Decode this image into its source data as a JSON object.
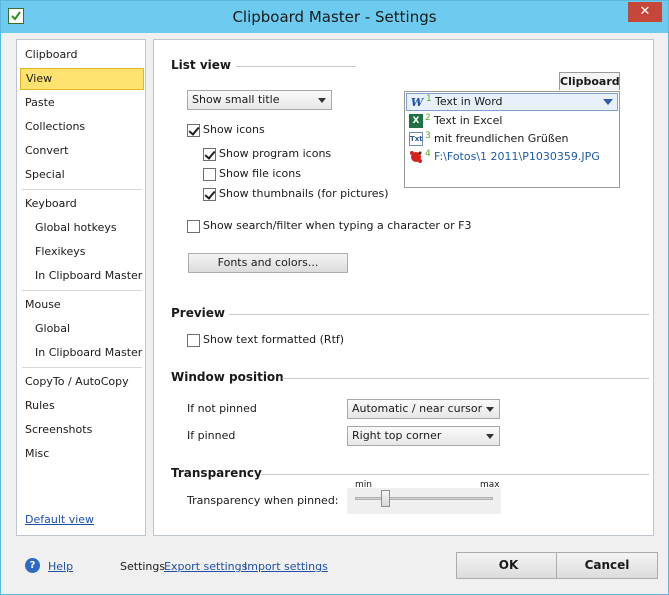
{
  "window": {
    "title": "Clipboard Master - Settings",
    "close_label": "✕"
  },
  "sidebar": {
    "items": [
      {
        "label": "Clipboard"
      },
      {
        "label": "View"
      },
      {
        "label": "Paste"
      },
      {
        "label": "Collections"
      },
      {
        "label": "Convert"
      },
      {
        "label": "Special"
      },
      {
        "label": "Keyboard"
      },
      {
        "label": "Global hotkeys"
      },
      {
        "label": "Flexikeys"
      },
      {
        "label": "In Clipboard Master"
      },
      {
        "label": "Mouse"
      },
      {
        "label": "Global"
      },
      {
        "label": "In Clipboard Master"
      },
      {
        "label": "CopyTo / AutoCopy"
      },
      {
        "label": "Rules"
      },
      {
        "label": "Screenshots"
      },
      {
        "label": "Misc"
      }
    ],
    "selected": "View",
    "default_view_link": "Default view"
  },
  "list_view": {
    "title": "List view",
    "title_dropdown": "Show small title",
    "show_icons": "Show icons",
    "show_program_icons": "Show program icons",
    "show_file_icons": "Show file icons",
    "show_thumbnails": "Show thumbnails (for pictures)",
    "show_search": "Show search/filter when typing a character or F3",
    "fonts_button": "Fonts and colors..."
  },
  "clipboard_preview": {
    "title": "Clipboard",
    "items": [
      {
        "num": "1",
        "text": "Text in Word",
        "icon": "word-icon"
      },
      {
        "num": "2",
        "text": "Text in Excel",
        "icon": "excel-icon"
      },
      {
        "num": "3",
        "text": "mit freundlichen Grüßen",
        "icon": "text-icon"
      },
      {
        "num": "4",
        "text": "F:\\Fotos\\1 2011\\P1030359.JPG",
        "icon": "image-icon"
      }
    ]
  },
  "preview": {
    "title": "Preview",
    "show_rtf": "Show text formatted (Rtf)"
  },
  "window_position": {
    "title": "Window position",
    "not_pinned_label": "If not pinned",
    "not_pinned_value": "Automatic / near cursor",
    "pinned_label": "If pinned",
    "pinned_value": "Right top corner"
  },
  "transparency": {
    "title": "Transparency",
    "label": "Transparency when pinned:",
    "min": "min",
    "max": "max",
    "level": 0.2
  },
  "footer": {
    "help": "Help",
    "settings_label": "Settings",
    "export": "Export settings",
    "import": "Import settings",
    "ok": "OK",
    "cancel": "Cancel"
  },
  "colors": {
    "titlebar": "#6ccbee",
    "selection": "#ffe270",
    "link": "#1f4fa8"
  }
}
